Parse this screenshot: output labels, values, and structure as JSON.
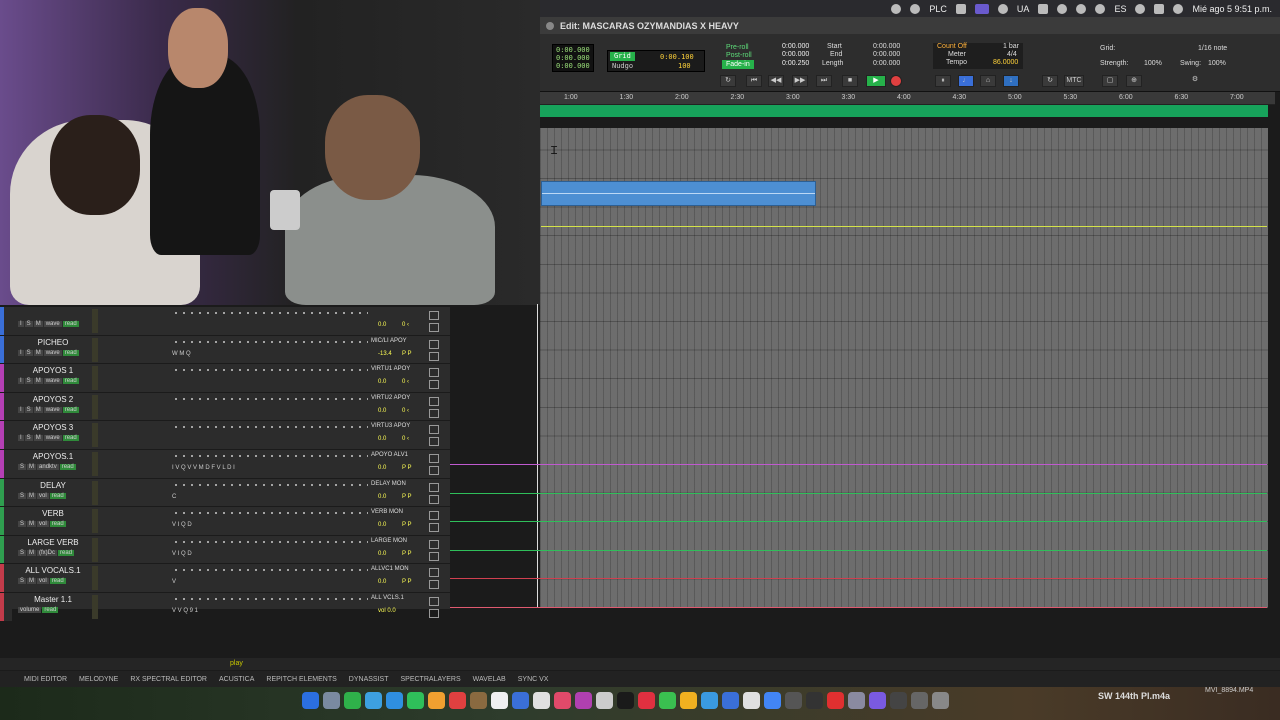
{
  "window": {
    "title": "Edit: MASCARAS OZYMANDIAS X HEAVY"
  },
  "menubar": {
    "plc": "PLC",
    "lang": "UA",
    "es": "ES",
    "clock": "Mié ago 5  9:51 p.m."
  },
  "transport": {
    "counter_main": [
      "0:00.000",
      "0:00.000",
      "0:00.000"
    ],
    "grid_label": "Grid",
    "nudge_label": "Nudgo",
    "grid_value": "0:00.100",
    "nudge_value": "100",
    "preroll_label": "Pre-roll",
    "postroll_label": "Post-roll",
    "fadein_label": "Fade-in",
    "preroll_value": "0:00.000",
    "postroll_value": "0:00.000",
    "fadein_value": "0:00.250",
    "start_label": "Start",
    "end_label": "End",
    "length_label": "Length",
    "start_value": "0:00.000",
    "end_value": "0:00.000",
    "length_value": "0:00.000",
    "countoff_label": "Count Off",
    "meter_label": "Meter",
    "tempo_label": "Tempo",
    "countoff_value": "1 bar",
    "meter_value": "4/4",
    "tempo_value": "86.0000",
    "grid_right_label": "Grid:",
    "grid_right_value": "1/16 note",
    "strength_label": "Strength:",
    "strength_value": "100%",
    "swing_label": "Swing:",
    "swing_value": "100%",
    "mtc": "MTC"
  },
  "ruler": {
    "ticks": [
      "1:00",
      "1:30",
      "2:00",
      "2:30",
      "3:00",
      "3:30",
      "4:00",
      "4:30",
      "5:00",
      "5:30",
      "6:00",
      "6:30",
      "7:00"
    ]
  },
  "tracks": [
    {
      "name": "",
      "btns": [
        "I",
        "S",
        "M",
        "wave",
        "read"
      ],
      "io": "",
      "vol": "0.0",
      "pan": "0 ‹",
      "color": "#3a6fd8"
    },
    {
      "name": "PICHEO",
      "btns": [
        "I",
        "S",
        "M",
        "wave",
        "read"
      ],
      "io": "MIC/LI APOY",
      "vol": "-13.4",
      "pan": "P P",
      "color": "#3a6fd8",
      "inserts": "W M Q"
    },
    {
      "name": "APOYOS 1",
      "btns": [
        "I",
        "S",
        "M",
        "wave",
        "read"
      ],
      "io": "VIRTU1 APOY",
      "vol": "0.0",
      "pan": "0 ‹",
      "color": "#b43fb4"
    },
    {
      "name": "APOYOS 2",
      "btns": [
        "I",
        "S",
        "M",
        "wave",
        "read"
      ],
      "io": "VIRTU2 APOY",
      "vol": "0.0",
      "pan": "0 ‹",
      "color": "#b43fb4"
    },
    {
      "name": "APOYOS 3",
      "btns": [
        "I",
        "S",
        "M",
        "wave",
        "read"
      ],
      "io": "VIRTU3 APOY",
      "vol": "0.0",
      "pan": "0 ‹",
      "color": "#b43fb4"
    },
    {
      "name": "APOYOS.1",
      "btns": [
        "S",
        "M",
        "andktv",
        "read"
      ],
      "io": "APOYO ALV1",
      "vol": "0.0",
      "pan": "P P",
      "color": "#b43fb4",
      "inserts": "I V Q V   V M D F   V L D I"
    },
    {
      "name": "DELAY",
      "btns": [
        "S",
        "M",
        "vol",
        "read"
      ],
      "io": "DELAY MON",
      "vol": "0.0",
      "pan": "P P",
      "color": "#2f9e4f",
      "inserts": "C"
    },
    {
      "name": "VERB",
      "btns": [
        "S",
        "M",
        "vol",
        "read"
      ],
      "io": "VERB MON",
      "vol": "0.0",
      "pan": "P P",
      "color": "#2f9e4f",
      "inserts": "V I Q          D"
    },
    {
      "name": "LARGE VERB",
      "btns": [
        "S",
        "M",
        "(fx)Dc",
        "read"
      ],
      "io": "LARGE MON",
      "vol": "0.0",
      "pan": "P P",
      "color": "#2f9e4f",
      "inserts": "V I Q          D"
    },
    {
      "name": "ALL VOCALS.1",
      "btns": [
        "S",
        "M",
        "vol",
        "read"
      ],
      "io": "ALLVC1 MON",
      "vol": "0.0",
      "pan": "P P",
      "color": "#c23b4a",
      "inserts": "V"
    },
    {
      "name": "Master 1.1",
      "btns": [
        "volume",
        "read"
      ],
      "io": "ALL VCLS.1",
      "vol": "vol  0.0",
      "pan": "",
      "color": "#c23b4a",
      "inserts": "V V Q 9 1"
    }
  ],
  "status": {
    "play": "play"
  },
  "plugins": [
    "MIDI EDITOR",
    "MELODYNE",
    "RX SPECTRAL EDITOR",
    "ACUSTICA",
    "REPITCH ELEMENTS",
    "DYNASSIST",
    "SPECTRALAYERS",
    "WAVELAB",
    "SYNC VX"
  ],
  "dock": {
    "file": "SW 144th Pl.m4a",
    "file2": "MVI_8894.MP4"
  },
  "colors": {
    "accent_green": "#26b14a",
    "marker_green": "#17a35b",
    "clip_blue": "#4d8fd3"
  }
}
